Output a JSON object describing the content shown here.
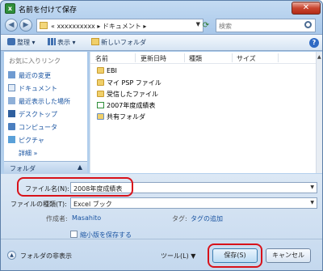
{
  "window": {
    "title": "名前を付けて保存",
    "app_icon": "excel-icon",
    "close_label": "✕"
  },
  "address": {
    "path": "« xxxxxxxxxx ▸ ドキュメント ▸",
    "search_placeholder": "検索"
  },
  "toolbar": {
    "organize": "整理",
    "views": "表示",
    "new_folder": "新しいフォルダ"
  },
  "sidebar": {
    "header": "お気に入りリンク",
    "items": [
      "最近の変更",
      "ドキュメント",
      "最近表示した場所",
      "デスクトップ",
      "コンピュータ",
      "ピクチャ"
    ],
    "more": "詳細 »",
    "folders_bar": "フォルダ"
  },
  "list": {
    "columns": [
      "名前",
      "更新日時",
      "種類",
      "サイズ"
    ],
    "rows": [
      {
        "name": "EBI",
        "icon": "folder-icon"
      },
      {
        "name": "マイ PSP ファイル",
        "icon": "folder-icon"
      },
      {
        "name": "受信したファイル",
        "icon": "folder-icon"
      },
      {
        "name": "2007年度成績表",
        "icon": "excel-file-icon"
      },
      {
        "name": "共有フォルダ",
        "icon": "shared-folder-icon"
      }
    ]
  },
  "form": {
    "filename_label": "ファイル名(N):",
    "filename_value": "2008年度成績表",
    "filetype_label": "ファイルの種類(T):",
    "filetype_value": "Excel ブック",
    "author_label": "作成者:",
    "author_value": "Masahito",
    "tags_label": "タグ:",
    "tags_value": "タグの追加",
    "thumbnail_label": "縮小版を保存する"
  },
  "footer": {
    "hide_folders": "フォルダの非表示",
    "tools": "ツール(L)",
    "save": "保存(S)",
    "cancel": "キャンセル"
  },
  "colors": {
    "highlight": "#d8121a",
    "link": "#1a54a1"
  }
}
